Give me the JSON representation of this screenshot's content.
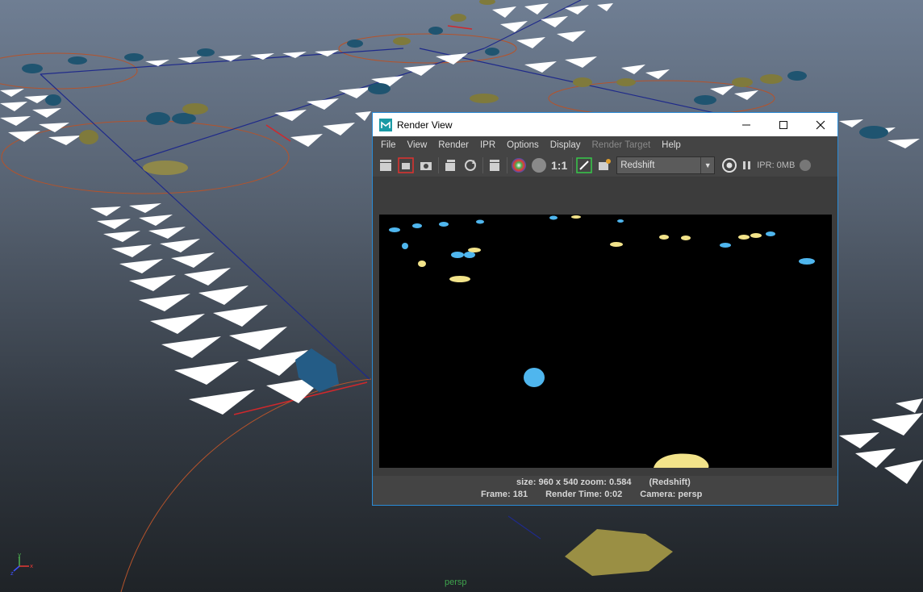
{
  "viewport": {
    "camera_label": "persp",
    "axis": {
      "x": "x",
      "y": "y",
      "z": "z"
    }
  },
  "render_view": {
    "title": "Render View",
    "menu": [
      {
        "label": "File",
        "enabled": true
      },
      {
        "label": "View",
        "enabled": true
      },
      {
        "label": "Render",
        "enabled": true
      },
      {
        "label": "IPR",
        "enabled": true
      },
      {
        "label": "Options",
        "enabled": true
      },
      {
        "label": "Display",
        "enabled": true
      },
      {
        "label": "Render Target",
        "enabled": false
      },
      {
        "label": "Help",
        "enabled": true
      }
    ],
    "toolbar": {
      "ratio_label": "1:1",
      "renderer": "Redshift",
      "ipr_label": "IPR: 0MB"
    },
    "status": {
      "size_zoom": "size: 960 x 540 zoom: 0.584",
      "engine": "(Redshift)",
      "frame": "Frame: 181",
      "render_time": "Render Time: 0:02",
      "camera": "Camera: persp"
    }
  },
  "colors": {
    "accent_border": "#2a8bd6",
    "viewport_label": "#3fa34d",
    "render_car_blue": "#4fb6ee",
    "render_car_yellow": "#f2e38a"
  }
}
